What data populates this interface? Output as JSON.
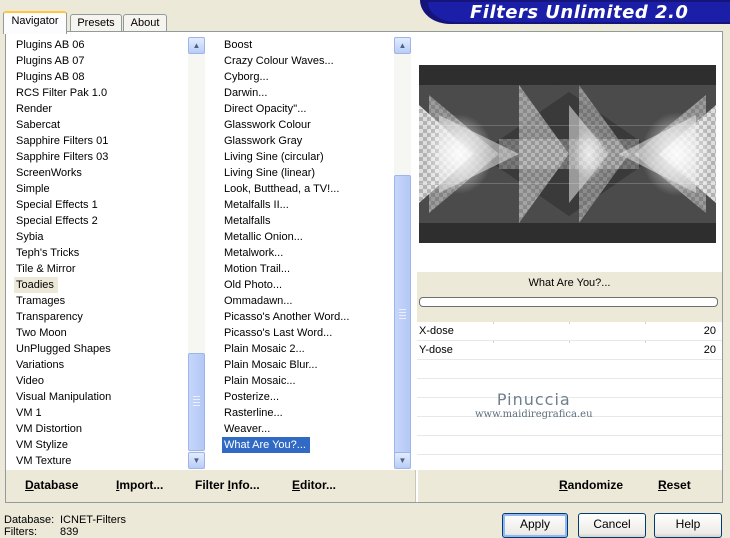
{
  "tabs": [
    {
      "label": "Navigator",
      "active": true
    },
    {
      "label": "Presets",
      "active": false
    },
    {
      "label": "About",
      "active": false
    }
  ],
  "banner": {
    "title": "Filters Unlimited 2.0"
  },
  "categories": {
    "items": [
      "Plugins AB 06",
      "Plugins AB 07",
      "Plugins AB 08",
      "RCS Filter Pak 1.0",
      "Render",
      "Sabercat",
      "Sapphire Filters 01",
      "Sapphire Filters 03",
      "ScreenWorks",
      "Simple",
      "Special Effects 1",
      "Special Effects 2",
      "Sybia",
      "Teph's Tricks",
      "Tile & Mirror",
      "Toadies",
      "Tramages",
      "Transparency",
      "Two Moon",
      "UnPlugged Shapes",
      "Variations",
      "Video",
      "Visual Manipulation",
      "VM 1",
      "VM Distortion",
      "VM Stylize",
      "VM Texture"
    ],
    "selected": "Toadies"
  },
  "filters": {
    "items": [
      "Boost",
      "Crazy Colour Waves...",
      "Cyborg...",
      "Darwin...",
      "Direct Opacity''...",
      "Glasswork Colour",
      "Glasswork Gray",
      "Living Sine (circular)",
      "Living Sine (linear)",
      "Look, Butthead, a TV!...",
      "Metalfalls II...",
      "Metalfalls",
      "Metallic Onion...",
      "Metalwork...",
      "Motion Trail...",
      "Old Photo...",
      "Ommadawn...",
      "Picasso's Another Word...",
      "Picasso's Last Word...",
      "Plain Mosaic 2...",
      "Plain Mosaic Blur...",
      "Plain Mosaic...",
      "Posterize...",
      "Rasterline...",
      "Weaver...",
      "What Are You?..."
    ],
    "selected": "What Are You?..."
  },
  "preview": {
    "filter_name": "What Are You?..."
  },
  "params": [
    {
      "label": "X-dose",
      "value": "20"
    },
    {
      "label": "Y-dose",
      "value": "20"
    }
  ],
  "watermark": {
    "name": "Pinuccia",
    "url": "www.maidiregrafica.eu"
  },
  "links": {
    "database": {
      "u": "D",
      "rest": "atabase"
    },
    "import": {
      "u": "I",
      "rest": "mport..."
    },
    "filter_info": {
      "pre": "Filter ",
      "u": "I",
      "rest": "nfo..."
    },
    "editor": {
      "u": "E",
      "rest": "ditor..."
    },
    "randomize": {
      "u": "R",
      "rest": "andomize"
    },
    "reset": {
      "u": "R",
      "rest": "eset"
    }
  },
  "footer": {
    "database_label": "Database:",
    "database_value": "ICNET-Filters",
    "filters_label": "Filters:",
    "filters_value": "839"
  },
  "buttons": {
    "apply": "Apply",
    "cancel": "Cancel",
    "help": "Help"
  }
}
